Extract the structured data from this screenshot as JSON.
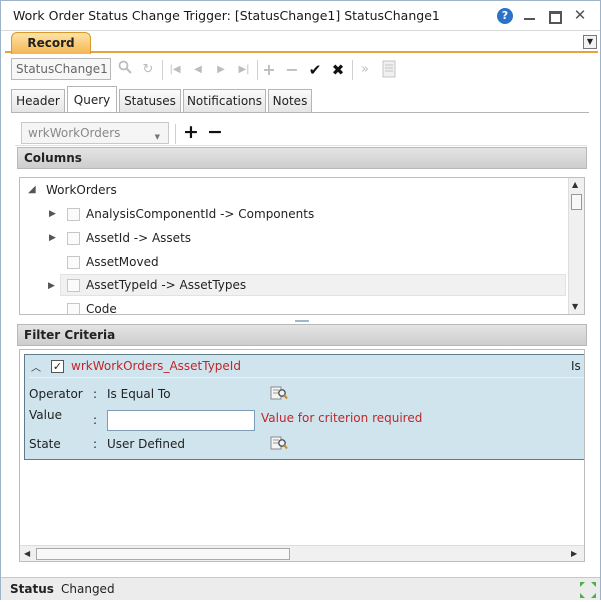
{
  "window": {
    "title": "Work Order Status Change Trigger: [StatusChange1] StatusChange1",
    "help_label": "?",
    "close_label": "✕"
  },
  "record_tab": {
    "label": "Record"
  },
  "toolbar": {
    "name_value": "StatusChange1"
  },
  "tabs": [
    {
      "label": "Header",
      "active": false
    },
    {
      "label": "Query",
      "active": true
    },
    {
      "label": "Statuses",
      "active": false
    },
    {
      "label": "Notifications",
      "active": false
    },
    {
      "label": "Notes",
      "active": false
    }
  ],
  "query": {
    "source_select": "wrkWorkOrders",
    "add_label": "+",
    "remove_label": "−",
    "columns_header": "Columns",
    "tree": {
      "root": "WorkOrders",
      "items": [
        {
          "label": "AnalysisComponentId -> Components",
          "expandable": true
        },
        {
          "label": "AssetId -> Assets",
          "expandable": true
        },
        {
          "label": "AssetMoved",
          "expandable": false
        },
        {
          "label": "AssetTypeId -> AssetTypes",
          "expandable": true,
          "highlighted": true
        },
        {
          "label": "Code",
          "expandable": false
        }
      ]
    },
    "filter_header": "Filter Criteria",
    "criterion": {
      "name": "wrkWorkOrders_AssetTypeId",
      "truncated_text": "Is",
      "checked": true,
      "operator_label": "Operator",
      "operator_value": "Is Equal To",
      "value_label": "Value",
      "value_error": "Value for criterion required",
      "state_label": "State",
      "state_value": "User Defined",
      "colon": ":"
    }
  },
  "status": {
    "label": "Status",
    "value": "Changed"
  }
}
